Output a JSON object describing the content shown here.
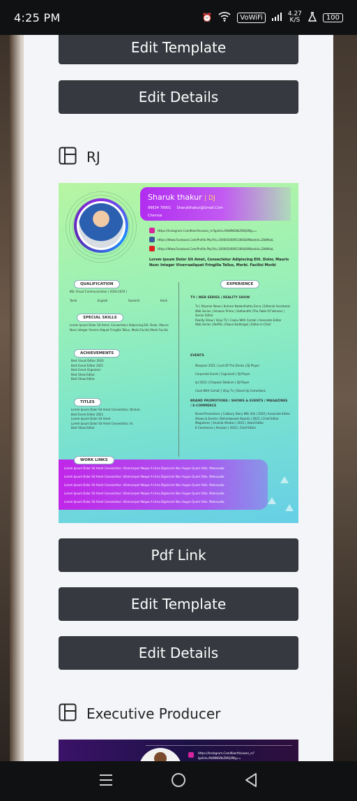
{
  "status_bar": {
    "time": "4:25 PM",
    "network": "VoWiFi",
    "speed_value": "4.27",
    "speed_unit": "K/S",
    "battery": "100"
  },
  "buttons": {
    "edit_template": "Edit Template",
    "edit_details": "Edit Details",
    "pdf_link": "Pdf Link"
  },
  "sections": [
    {
      "title": "RJ",
      "icon": "template-icon"
    },
    {
      "title": "Executive Producer",
      "icon": "template-icon"
    }
  ],
  "resume_preview": {
    "name": "Sharuk thakur",
    "role": "DJ",
    "phone": "99634 78901",
    "email": "Sharukthakur@Gmail.Com",
    "location": "Chennai",
    "social_links": [
      "Https://Instagram.Com/Keerthivasan_rs?Igshid=MzNlNGNkZWQ4Mg==",
      "Https://Www.Facebook.Com/Profile.Php?Id=100005460913064&Mibextid=ZbWKwL",
      "Https://Www.Facebook.Com/Profile.Php?Id=100005460913064&Mibextid=ZbWKwL"
    ],
    "summary": "Lorem Ipsum Dolor Sit Amet, Consectetur Adipiscing Elit. Dolor, Mauris Nunc Integer Viverraaliquet Fringilla Tellus, Morbi. Facilisi Morbi",
    "qualification_title": "QUALIFICATION",
    "qualification": "BSc Visual Communication ( 2016-2019 )",
    "languages": [
      "Tamil",
      "English",
      "Sanskrit",
      "Hindi"
    ],
    "special_skills_title": "SPECIAL SKILLS",
    "special_skills": "Lorem Ipsum Dolor Sit Amet, Consectetur Adipiscing Elit. Dolor, Mauris Nunc Integer Viverra Aliquet Fringilla Tellus, Morbi Facilisi Morbi Facilisi",
    "achievements_title": "ACHIEVEMENTS",
    "achievements": [
      "Best Visual Editor 2020",
      "Best Event Editor 2021",
      "Best Event Organizer",
      "Best Show Editor",
      "Best Show Editor"
    ],
    "titles_title": "TITLES",
    "titles": [
      "Lorem Ipsum Dolor Sit Amet Consectetur. Dictum.",
      "Best Event Editor 2021",
      "Lorem Ipsum Dolor Sit Amet",
      "Lorem Ipsum Dolor Sit Amet Consectetur. Id.",
      "Best Show Editor"
    ],
    "experience_title": "EXPERIENCE",
    "tv_heading": "TV | WEB SERIES | REALITY SHOW",
    "tv_items": [
      "Tv | Polymer News | Kutram Nadanthathu Enna | Editorial Assistants",
      "Web Series | Amazon Prime | Vadhandhi (The Fable Of Velonie) | Senior Editor",
      "Reality Show | Vijay TV | Cooku With Comali | Associate Editor",
      "Web Series | Netflix | Paava Kadhaigal | Editor-in-Chief"
    ],
    "events_heading": "EVENTS",
    "events_items": [
      "Newyear 2021 | Lord Of The Drinks | DJ Player",
      "Corporate Event | Cognizant | DJ Player",
      "Ipl 2023 | Chepauk Stadium | DJ Player",
      "Cook With Comali | Vijay Tv | Stand Up Comedians"
    ],
    "brand_heading": "BRAND PROMOTIONS / SHOWS & EVENTS / MAGAZINES / E-COMMERCE",
    "brand_items": [
      "Brand Promotions | Cadbury Dairy Milk Silk | 2020 | Associate Editor",
      "Shows & Events | Behindwoods Awards | 2021 | Chief Editor",
      "Magazines | Ananda Vikatan | 2021 | Head Editor",
      "E-Commerce | Amazon | 2022 | Chief Editor"
    ],
    "work_links_title": "WORK LINKS",
    "work_links": [
      "Lorem Ipsum Dolor Sit Amet Consectetur. Ullamcorper Neque A Urna Dignissim Non Augue Quam Odio. Malesuada",
      "Lorem Ipsum Dolor Sit Amet Consectetur. Ullamcorper Neque A Urna Dignissim Non Augue Quam Odio. Malesuada",
      "Lorem Ipsum Dolor Sit Amet Consectetur. Ullamcorper Neque A Urna Dignissim Non Augue Quam Odio. Malesuada",
      "Lorem Ipsum Dolor Sit Amet Consectetur. Ullamcorper Neque A Urna Dignissim Non Augue Quam Odio. Malesuada",
      "Lorem Ipsum Dolor Sit Amet Consectetur. Ullamcorper Neque A Urna Dignissim Non Augue Quam Odio. Malesuada"
    ]
  },
  "resume_preview_2": {
    "social_link": "Https://Instagram.Com/Keerthivasan_rs?Igshid=MzNlNGNkZWQ4Mg=="
  },
  "nav_bar": {
    "recents_icon": "recents-icon",
    "home_icon": "home-icon",
    "back_icon": "back-icon"
  }
}
